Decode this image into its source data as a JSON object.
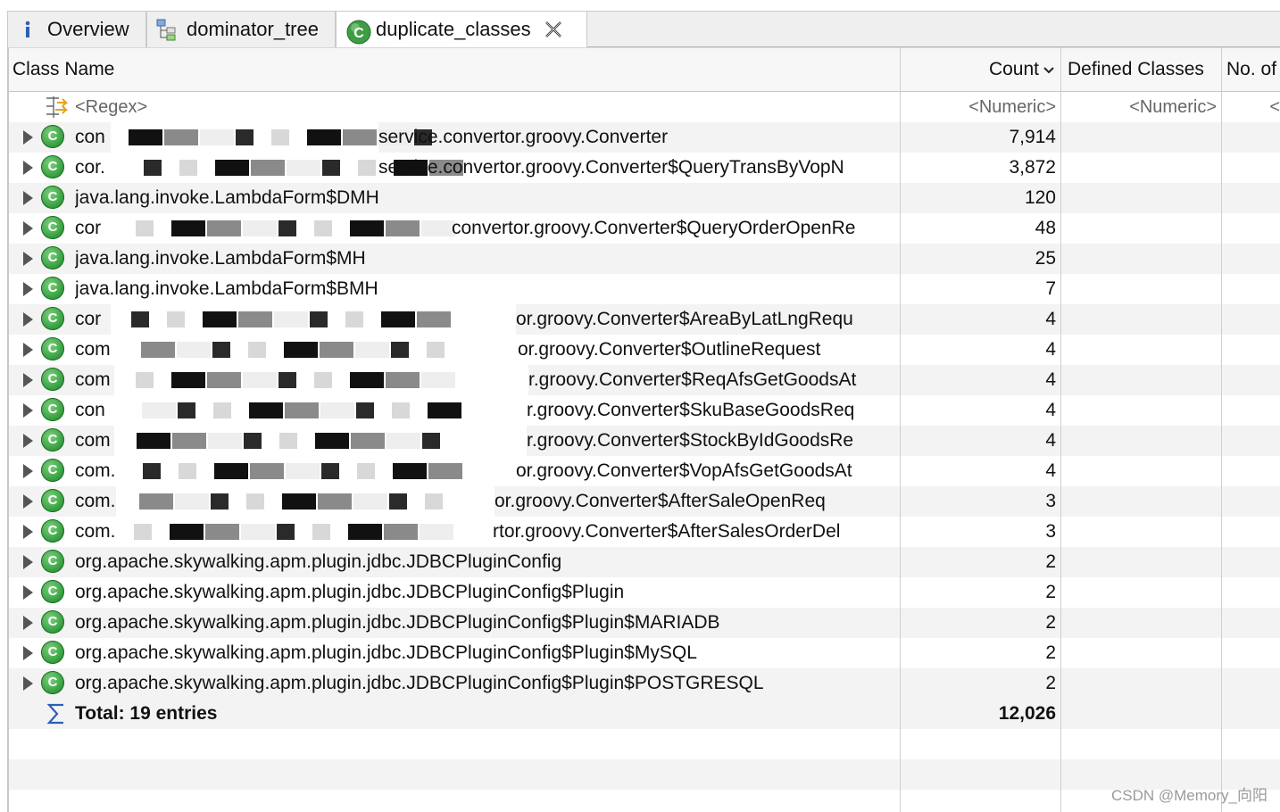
{
  "tabs": [
    {
      "label": "Overview",
      "icon": "info-icon"
    },
    {
      "label": "dominator_tree",
      "icon": "dominator-tree-icon"
    },
    {
      "label": "duplicate_classes",
      "icon": "class-icon",
      "active": true
    }
  ],
  "columns": {
    "class_name": "Class Name",
    "count": "Count",
    "defined_classes": "Defined Classes",
    "no_of": "No. of"
  },
  "filters": {
    "regex": "<Regex>",
    "count": "<Numeric>",
    "defined": "<Numeric>",
    "no_of": "<"
  },
  "rows": [
    {
      "name": "con",
      "name_end": "service.convertor.groovy.Converter",
      "count": "7,914"
    },
    {
      "name": "cor.",
      "name_end": "service.convertor.groovy.Converter$QueryTransByVopN",
      "count": "3,872"
    },
    {
      "name": "java.lang.invoke.LambdaForm$DMH",
      "name_end": "",
      "count": "120"
    },
    {
      "name": "cor",
      "name_end": "convertor.groovy.Converter$QueryOrderOpenRe",
      "count": "48"
    },
    {
      "name": "java.lang.invoke.LambdaForm$MH",
      "name_end": "",
      "count": "25"
    },
    {
      "name": "java.lang.invoke.LambdaForm$BMH",
      "name_end": "",
      "count": "7"
    },
    {
      "name": "cor",
      "name_end": "or.groovy.Converter$AreaByLatLngRequ",
      "count": "4"
    },
    {
      "name": "com",
      "name_end": "or.groovy.Converter$OutlineRequest",
      "count": "4"
    },
    {
      "name": "com",
      "name_end": "r.groovy.Converter$ReqAfsGetGoodsAt",
      "count": "4"
    },
    {
      "name": "con",
      "name_end": "r.groovy.Converter$SkuBaseGoodsReq",
      "count": "4"
    },
    {
      "name": "com",
      "name_end": "r.groovy.Converter$StockByIdGoodsRe",
      "count": "4"
    },
    {
      "name": "com.",
      "name_end": "or.groovy.Converter$VopAfsGetGoodsAt",
      "count": "4"
    },
    {
      "name": "com.",
      "name_end": "or.groovy.Converter$AfterSaleOpenReq",
      "count": "3"
    },
    {
      "name": "com.",
      "name_end": "rtor.groovy.Converter$AfterSalesOrderDel",
      "count": "3"
    },
    {
      "name": "org.apache.skywalking.apm.plugin.jdbc.JDBCPluginConfig",
      "name_end": "",
      "count": "2"
    },
    {
      "name": "org.apache.skywalking.apm.plugin.jdbc.JDBCPluginConfig$Plugin",
      "name_end": "",
      "count": "2"
    },
    {
      "name": "org.apache.skywalking.apm.plugin.jdbc.JDBCPluginConfig$Plugin$MARIADB",
      "name_end": "",
      "count": "2"
    },
    {
      "name": "org.apache.skywalking.apm.plugin.jdbc.JDBCPluginConfig$Plugin$MySQL",
      "name_end": "",
      "count": "2"
    },
    {
      "name": "org.apache.skywalking.apm.plugin.jdbc.JDBCPluginConfig$Plugin$POSTGRESQL",
      "name_end": "",
      "count": "2"
    }
  ],
  "total": {
    "label": "Total: 19 entries",
    "count": "12,026",
    "icon": "sum-icon"
  },
  "watermark": "CSDN @Memory_向阳",
  "colors": {
    "class_icon": "#2f9a3a",
    "stripe": "#f3f3f3",
    "tab_bar": "#efefef"
  }
}
